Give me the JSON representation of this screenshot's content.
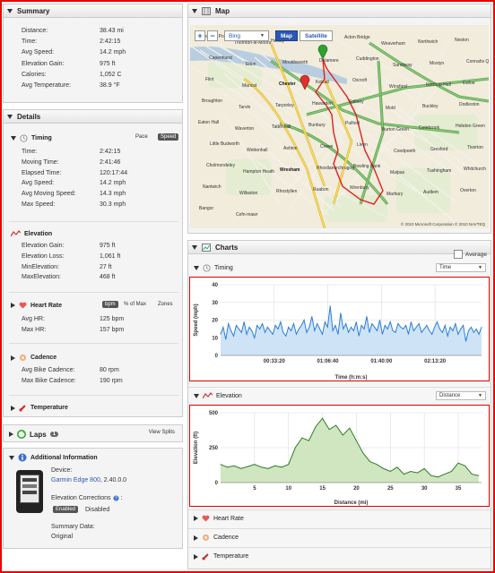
{
  "summary": {
    "title": "Summary",
    "rows": [
      {
        "label": "Distance:",
        "value": "38.43 mi"
      },
      {
        "label": "Time:",
        "value": "2:42:15"
      },
      {
        "label": "Avg Speed:",
        "value": "14.2 mph"
      },
      {
        "label": "Elevation Gain:",
        "value": "975 ft"
      },
      {
        "label": "Calories:",
        "value": "1,052 C"
      },
      {
        "label": "Avg Temperature:",
        "value": "38.9 °F"
      }
    ]
  },
  "details": {
    "title": "Details",
    "timing": {
      "title": "Timing",
      "pace": "Pace",
      "speed": "Speed",
      "rows": [
        {
          "label": "Time:",
          "value": "2:42:15"
        },
        {
          "label": "Moving Time:",
          "value": "2:41:46"
        },
        {
          "label": "Elapsed Time:",
          "value": "120:17:44"
        },
        {
          "label": "Avg Speed:",
          "value": "14.2 mph"
        },
        {
          "label": "Avg Moving Speed:",
          "value": "14.3 mph"
        },
        {
          "label": "Max Speed:",
          "value": "30.3 mph"
        }
      ]
    },
    "elevation": {
      "title": "Elevation",
      "rows": [
        {
          "label": "Elevation Gain:",
          "value": "975 ft"
        },
        {
          "label": "Elevation Loss:",
          "value": "1,061 ft"
        },
        {
          "label": "MinElevation:",
          "value": "27 ft"
        },
        {
          "label": "MaxElevation:",
          "value": "468 ft"
        }
      ]
    },
    "heart": {
      "title": "Heart Rate",
      "bpm": "bpm",
      "pct": "% of Max",
      "zones": "Zones",
      "rows": [
        {
          "label": "Avg HR:",
          "value": "125 bpm"
        },
        {
          "label": "Max HR:",
          "value": "157 bpm"
        }
      ]
    },
    "cadence": {
      "title": "Cadence",
      "rows": [
        {
          "label": "Avg Bike Cadence:",
          "value": "80 rpm"
        },
        {
          "label": "Max Bike Cadence:",
          "value": "190 rpm"
        }
      ]
    },
    "temperature": {
      "title": "Temperature"
    }
  },
  "laps": {
    "title": "Laps",
    "count": "1",
    "view": "View Splits"
  },
  "info": {
    "title": "Additional Information",
    "device_label": "Device:",
    "device": "Garmin Edge 800",
    "device_ver": ", 2.40.0.0",
    "corr_label": "Elevation Corrections",
    "corr_suffix": ":",
    "enabled": "Enabled",
    "disabled": "Disabled",
    "summary_label": "Summary Data:",
    "summary_val": "Original"
  },
  "map": {
    "title": "Map",
    "bing": "Bing",
    "map": "Map",
    "satellite": "Satellite",
    "plus": "+",
    "minus": "−",
    "places": [
      "Ellesmere Port",
      "Thornton-le-Moors",
      "Helsby",
      "Frodsham",
      "Acton Bridge",
      "Weaverham",
      "Northwich",
      "Neston",
      "Capenhurst",
      "Elton",
      "Mouldsworth",
      "Delamere",
      "Cuddington",
      "Sandiway",
      "Mostyn",
      "Connahs Quay",
      "Flint",
      "Mancot",
      "Chester",
      "Kelsall",
      "Oscroft",
      "Winsford",
      "Northop Hall",
      "Ewloe",
      "Broughton",
      "Tarvin",
      "Tarporley",
      "Hawarden",
      "Saltney",
      "Mold",
      "Buckley",
      "Dodleston",
      "Eaton Hall",
      "Waverton",
      "Tattenhall",
      "Bunbury",
      "Pulford",
      "Burton Green",
      "Cotebrook",
      "Hebden Green",
      "Little Budworth",
      "Wettenhall",
      "Ashton",
      "Crewe",
      "Lleyn",
      "Coedpoeth",
      "Gresford",
      "Tiverton",
      "Cholmondeley",
      "Hampton Heath",
      "Wrexham",
      "Rhosllanerchrugog",
      "Bowling Bank",
      "Malpas",
      "Tushingham",
      "Whitchurch",
      "Nantwich",
      "Willaston",
      "Rhostyllen",
      "Ruabon",
      "Wrenbury",
      "Marbury",
      "Audlem",
      "Overton",
      "Bangor",
      "Cefn-mawr"
    ],
    "copyright": "© 2010 Microsoft Corporation  © 2010 NAVTEQ"
  },
  "charts": {
    "title": "Charts",
    "average": "Average",
    "timing": {
      "title": "Timing",
      "select": "Time",
      "ylabel": "Speed (mph)",
      "xlabel": "Time (h:m:s)",
      "yticks": [
        "40",
        "30",
        "20",
        "10",
        "0"
      ],
      "xticks": [
        "00:33:20",
        "01:06:40",
        "01:40:00",
        "02:13:20"
      ]
    },
    "elevation": {
      "title": "Elevation",
      "select": "Distance",
      "ylabel": "Elevation (ft)",
      "xlabel": "Distance (mi)",
      "yticks": [
        "500",
        "250",
        "0"
      ],
      "xticks": [
        "5",
        "10",
        "15",
        "20",
        "25",
        "30",
        "35"
      ]
    },
    "collapsed": [
      {
        "title": "Heart Rate"
      },
      {
        "title": "Cadence"
      },
      {
        "title": "Temperature"
      }
    ]
  },
  "chart_data": [
    {
      "type": "area",
      "title": "Timing",
      "xlabel": "Time (h:m:s)",
      "ylabel": "Speed (mph)",
      "ylim": [
        0,
        40
      ],
      "x_seconds_range": [
        0,
        9735
      ],
      "values": [
        12,
        16,
        9,
        18,
        14,
        11,
        17,
        15,
        13,
        19,
        12,
        16,
        14,
        10,
        17,
        15,
        18,
        13,
        16,
        14,
        12,
        17,
        15,
        19,
        13,
        11,
        16,
        14,
        18,
        12,
        15,
        17,
        20,
        13,
        16,
        22,
        14,
        18,
        15,
        12,
        19,
        16,
        28,
        14,
        17,
        12,
        24,
        15,
        18,
        13,
        16,
        14,
        19,
        11,
        17,
        15,
        22,
        13,
        18,
        16,
        14,
        20,
        12,
        17,
        15,
        19,
        14,
        13,
        18,
        16,
        15,
        17,
        12,
        19,
        14,
        16,
        18,
        13,
        15,
        17,
        14,
        12,
        16,
        19,
        15,
        13,
        17,
        11,
        16,
        14,
        18,
        12,
        15,
        17,
        8,
        14,
        16,
        13,
        15,
        12,
        16
      ]
    },
    {
      "type": "area",
      "title": "Elevation",
      "xlabel": "Distance (mi)",
      "ylabel": "Elevation (ft)",
      "ylim": [
        0,
        500
      ],
      "xlim": [
        0,
        38.43
      ],
      "x": [
        0,
        1,
        2,
        3,
        4,
        5,
        6,
        7,
        8,
        9,
        10,
        11,
        12,
        13,
        14,
        15,
        16,
        17,
        18,
        19,
        20,
        21,
        22,
        23,
        24,
        25,
        26,
        27,
        28,
        29,
        30,
        31,
        32,
        33,
        34,
        35,
        36,
        37,
        38
      ],
      "values": [
        130,
        110,
        120,
        100,
        115,
        130,
        110,
        100,
        120,
        110,
        130,
        250,
        320,
        300,
        400,
        460,
        380,
        410,
        340,
        390,
        300,
        210,
        150,
        130,
        100,
        80,
        110,
        60,
        80,
        70,
        100,
        50,
        40,
        60,
        80,
        140,
        120,
        60,
        50
      ]
    }
  ]
}
